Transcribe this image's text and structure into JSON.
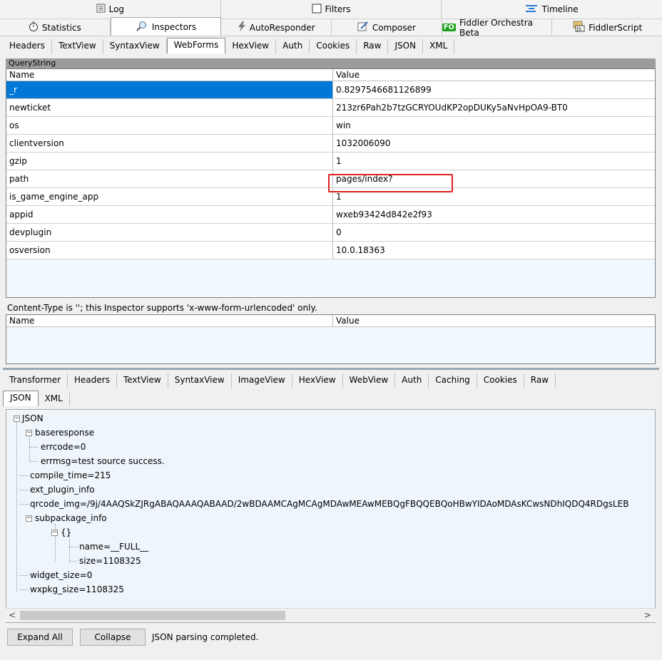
{
  "tabs_top": [
    {
      "label": "Log",
      "icon": "log-icon"
    },
    {
      "label": "Filters",
      "icon": "checkbox-icon"
    },
    {
      "label": "Timeline",
      "icon": "timeline-icon"
    }
  ],
  "tabs_main": [
    {
      "label": "Statistics",
      "icon": "stopwatch-icon"
    },
    {
      "label": "Inspectors",
      "icon": "magnifier-icon",
      "active": true
    },
    {
      "label": "AutoResponder",
      "icon": "lightning-icon"
    },
    {
      "label": "Composer",
      "icon": "pencil-icon"
    },
    {
      "label": "Fiddler Orchestra Beta",
      "icon": "fo-icon",
      "icon_text": "FO"
    },
    {
      "label": "FiddlerScript",
      "icon": "js-icon"
    }
  ],
  "request_subtabs": [
    "Headers",
    "TextView",
    "SyntaxView",
    "WebForms",
    "HexView",
    "Auth",
    "Cookies",
    "Raw",
    "JSON",
    "XML"
  ],
  "request_active_subtab": "WebForms",
  "querystring": {
    "title": "QueryString",
    "col_name": "Name",
    "col_value": "Value",
    "rows": [
      {
        "name": "_r",
        "value": "0.8297546681126899",
        "selected": true
      },
      {
        "name": "newticket",
        "value": "213zr6Pah2b7tzGCRYOUdKP2opDUKy5aNvHpOA9-BT0"
      },
      {
        "name": "os",
        "value": "win"
      },
      {
        "name": "clientversion",
        "value": "1032006090"
      },
      {
        "name": "gzip",
        "value": "1"
      },
      {
        "name": "path",
        "value": "pages/index?",
        "highlighted": true
      },
      {
        "name": "is_game_engine_app",
        "value": "1"
      },
      {
        "name": "appid",
        "value": "wxeb93424d842e2f93"
      },
      {
        "name": "devplugin",
        "value": "0"
      },
      {
        "name": "osversion",
        "value": "10.0.18363"
      }
    ]
  },
  "content_type_note": "Content-Type is ''; this Inspector supports 'x-www-form-urlencoded' only.",
  "body_grid": {
    "col_name": "Name",
    "col_value": "Value"
  },
  "response_tabs_row1": [
    "Transformer",
    "Headers",
    "TextView",
    "SyntaxView",
    "ImageView",
    "HexView",
    "WebView",
    "Auth",
    "Caching",
    "Cookies",
    "Raw"
  ],
  "response_tabs_row2": [
    "JSON",
    "XML"
  ],
  "response_active_tab": "JSON",
  "json_tree": {
    "root": "JSON",
    "baseresponse": "baseresponse",
    "errcode": "errcode=0",
    "errmsg": "errmsg=test source success.",
    "compile_time": "compile_time=215",
    "ext_plugin_info": "ext_plugin_info",
    "qrcode_img": "qrcode_img=/9j/4AAQSkZJRgABAQAAAQABAAD/2wBDAAMCAgMCAgMDAwMEAwMEBQgFBQQEBQoHBwYIDAoMDAsKCwsNDhIQDQ4RDgsLEB",
    "subpackage_info": "subpackage_info",
    "obj": "{}",
    "name": "name=__FULL__",
    "size": "size=1108325",
    "widget_size": "widget_size=0",
    "wxpkg_size": "wxpkg_size=1108325"
  },
  "buttons": {
    "expand_all": "Expand All",
    "collapse": "Collapse"
  },
  "status_text": "JSON parsing completed."
}
